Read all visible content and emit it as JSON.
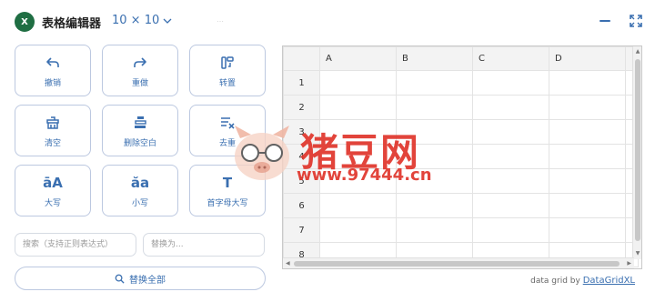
{
  "header": {
    "app_icon_text": "X",
    "title": "表格编辑器",
    "grid_size": "10 × 10",
    "hint": "…"
  },
  "tools": [
    {
      "label": "撤销",
      "icon": "undo-icon"
    },
    {
      "label": "重做",
      "icon": "redo-icon"
    },
    {
      "label": "转置",
      "icon": "transpose-icon"
    },
    {
      "label": "清空",
      "icon": "clear-icon"
    },
    {
      "label": "删除空白",
      "icon": "delete-blank-icon"
    },
    {
      "label": "去重",
      "icon": "dedupe-icon"
    },
    {
      "label": "大写",
      "icon": "uppercase-icon",
      "glyph": "āA"
    },
    {
      "label": "小写",
      "icon": "lowercase-icon",
      "glyph": "ăa"
    },
    {
      "label": "首字母大写",
      "icon": "capitalize-icon",
      "glyph": "T"
    }
  ],
  "search": {
    "placeholder": "搜索（支持正则表达式）"
  },
  "replace": {
    "placeholder": "替换为..."
  },
  "replace_all_label": "替换全部",
  "grid": {
    "columns": [
      "A",
      "B",
      "C",
      "D",
      ""
    ],
    "rows": [
      "1",
      "2",
      "3",
      "4",
      "5",
      "6",
      "7",
      "8"
    ]
  },
  "credit": {
    "prefix": "data grid by ",
    "link": "DataGridXL"
  },
  "watermark": {
    "text": "猪豆网",
    "url": "www.97444.cn"
  },
  "colors": {
    "accent": "#3a6fb0",
    "brand": "#1f6e43",
    "watermark": "#e0352b"
  }
}
